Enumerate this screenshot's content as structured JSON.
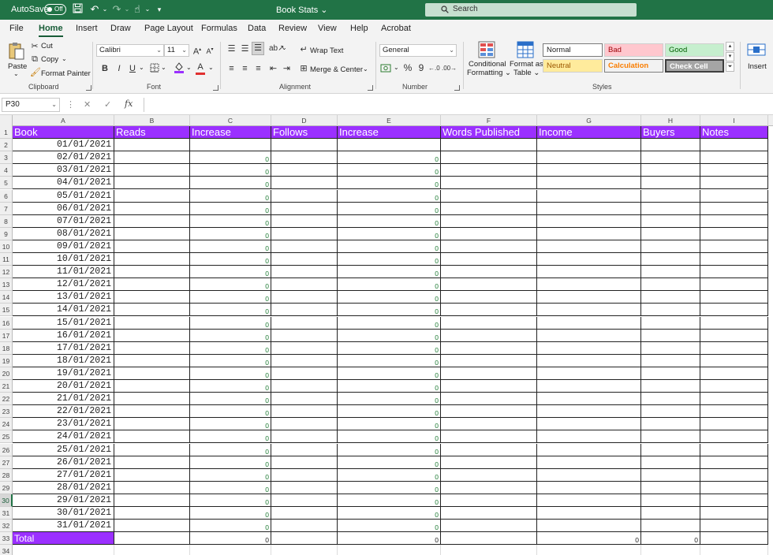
{
  "titlebar": {
    "autosave_label": "AutoSave",
    "autosave_state": "Off",
    "doc_title": "Book Stats",
    "search_placeholder": "Search"
  },
  "tabs": [
    "File",
    "Home",
    "Insert",
    "Draw",
    "Page Layout",
    "Formulas",
    "Data",
    "Review",
    "View",
    "Help",
    "Acrobat"
  ],
  "active_tab": "Home",
  "ribbon": {
    "clipboard": {
      "paste": "Paste",
      "cut": "Cut",
      "copy": "Copy",
      "format_painter": "Format Painter",
      "label": "Clipboard"
    },
    "font": {
      "name": "Calibri",
      "size": "11",
      "label": "Font",
      "bold": "B",
      "italic": "I",
      "underline": "U"
    },
    "alignment": {
      "wrap_text": "Wrap Text",
      "merge_center": "Merge & Center",
      "label": "Alignment"
    },
    "number": {
      "format": "General",
      "label": "Number",
      "percent": "%",
      "comma": "9"
    },
    "styles": {
      "conditional": "Conditional",
      "formatting": "Formatting",
      "format_as": "Format as",
      "table": "Table",
      "normal": "Normal",
      "bad": "Bad",
      "good": "Good",
      "neutral": "Neutral",
      "calculation": "Calculation",
      "check_cell": "Check Cell",
      "label": "Styles"
    },
    "cells": {
      "insert": "Insert"
    }
  },
  "formula_bar": {
    "name_box": "P30",
    "fx": "fx",
    "value": ""
  },
  "columns": [
    "A",
    "B",
    "C",
    "D",
    "E",
    "F",
    "G",
    "H",
    "I"
  ],
  "header_row": [
    "Book",
    "Reads",
    "Increase",
    "Follows",
    "Increase",
    "Words Published",
    "Income",
    "Buyers",
    "Notes"
  ],
  "dates": [
    "01/01/2021",
    "02/01/2021",
    "03/01/2021",
    "04/01/2021",
    "05/01/2021",
    "06/01/2021",
    "07/01/2021",
    "08/01/2021",
    "09/01/2021",
    "10/01/2021",
    "11/01/2021",
    "12/01/2021",
    "13/01/2021",
    "14/01/2021",
    "15/01/2021",
    "16/01/2021",
    "17/01/2021",
    "18/01/2021",
    "19/01/2021",
    "20/01/2021",
    "21/01/2021",
    "22/01/2021",
    "23/01/2021",
    "24/01/2021",
    "25/01/2021",
    "26/01/2021",
    "27/01/2021",
    "28/01/2021",
    "29/01/2021",
    "30/01/2021",
    "31/01/2021"
  ],
  "increase_value": "0",
  "total_row": {
    "label": "Total",
    "c": "0",
    "e": "0",
    "g": "0",
    "h": "0"
  },
  "selected_row": "30",
  "colors": {
    "header_bg": "#9b30ff",
    "excel_green": "#217346",
    "zero_green": "#1e7b34"
  }
}
